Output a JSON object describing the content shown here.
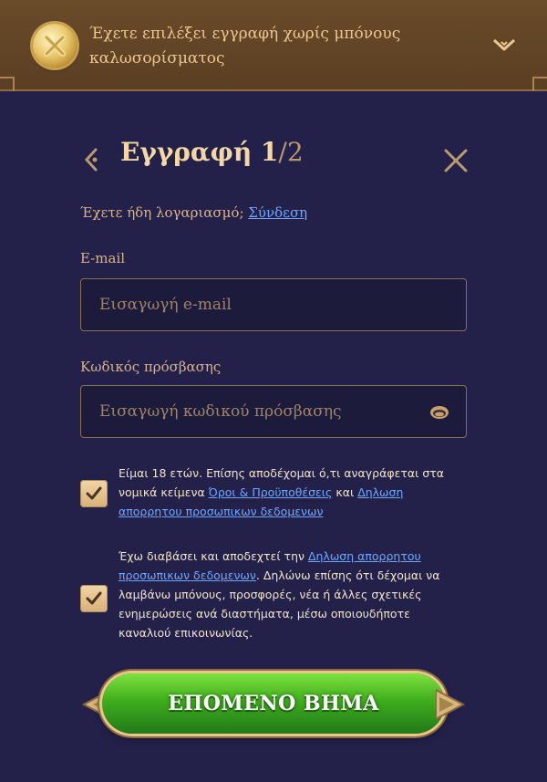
{
  "banner": {
    "message": "Έχετε επιλέξει εγγραφή χωρίς μπόνους καλωσορίσματος",
    "coin_icon": "no-bonus-coin-icon"
  },
  "header": {
    "title": "Εγγραφή 1",
    "step_suffix": "/2"
  },
  "login_prompt": {
    "text": "Έχετε ήδη λογαριασμό;",
    "link": "Σύνδεση"
  },
  "email": {
    "label": "E-mail",
    "placeholder": "Εισαγωγή e-mail",
    "value": ""
  },
  "password": {
    "label": "Κωδικός πρόσβασης",
    "placeholder": "Εισαγωγή κωδικού πρόσβασης",
    "value": ""
  },
  "consent_age": {
    "checked": true,
    "text_before": "Είμαι 18 ετών. Επίσης αποδέχομαι ό,τι αναγράφεται στα νομικά κείμενα",
    "terms_link": "Όροι & Προϋποθέσεις",
    "text_and": "και",
    "privacy_link": "Δηλωση απορρητου προσωπικων δεδομενων"
  },
  "consent_marketing": {
    "checked": true,
    "text_before": "Έχω διαβάσει και αποδεχτεί την",
    "privacy_link": "Δηλωση απορρητου προσωπικων δεδομενων",
    "text_after": ". Δηλώνω επίσης ότι δέχομαι να λαμβάνω μπόνους, προσφορές, νέα ή άλλες σχετικές ενημερώσεις ανά διαστήματα, μέσω οποιουδήποτε καναλιού επικοινωνίας."
  },
  "cta": {
    "label": "ΕΠΟΜΕΝΟ ΒΗΜΑ"
  },
  "colors": {
    "background": "#23214a",
    "banner": "#5b3f22",
    "accent_gold": "#e8c79a",
    "link": "#6ea6ff",
    "cta_green": "#3fae1c"
  }
}
